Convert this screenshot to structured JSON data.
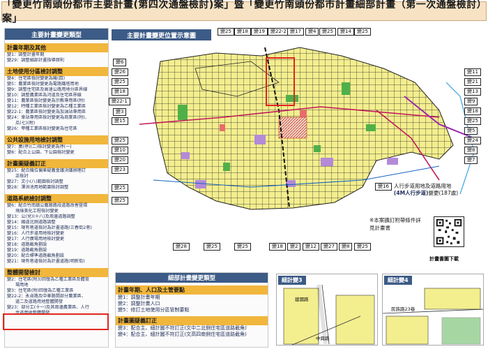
{
  "title": "「變更竹南頭份都市主要計畫(第四次通盤檢討)案」暨「變更竹南頭份都市計畫細部計畫（第一次通盤檢討）案」",
  "left_panel": {
    "header": "主要計畫變更類型",
    "categories": [
      {
        "title": "計畫年期及其他",
        "items": [
          "變1：調整計畫年期",
          "變29：調整細部計畫指導原則"
        ]
      },
      {
        "title": "土地使用分區檢討調整",
        "items": [
          "變4：住宅區檢討變更為機(四)",
          "變5：農業區檢討變更為電路鐵塔用地",
          "變9：調整住宅區及高速公路用地分區界線",
          "變10：調整農業區為河道及住宅區界線",
          "變11：農業區檢討變更為宗教專用區(附)",
          "變12：特種工業區檢討變更為乙種工業區",
          "變22-1：農業區檢討變更為加油站專用區",
          "變24：車站專用區檢討變更為商業區(附)、",
          "瓜(七)(附)",
          "變26：甲種工業區檢討變更為住宅區"
        ]
      },
      {
        "title": "公共設施用地檢討調整",
        "items": [
          "變7：廣(停)(二)檢討變更為停(一)",
          "變8：配合上公園、下公園檢討變更"
        ]
      },
      {
        "title": "計畫圖疑義訂正",
        "items": [
          "變25：配合機位偏差疑義會議決議辦理訂",
          "正檢討",
          "變27：文小(八)範圍檢討調整",
          "變28：澤洪池用地範圍檢討調整"
        ]
      },
      {
        "title": "道路系統檢討調整",
        "items": [
          "變6：配合竹南鎮公義路路段道路改善暨環",
          "境綠美化工程檢討變更",
          "變13：公(兒)(十八)及周邊道路調整",
          "變14：國道北側道路調整",
          "變15：現有巷道檢討為計畫道路(三春街2巷)",
          "變16：人行步道用地檢討變更",
          "變17：人行廣場用地檢討變更",
          "變18：道路截角劃設",
          "變19：道路截角劃設",
          "變20：配合標準道路截角劃設",
          "變21：現有巷道檢討為計畫道路(明新街)"
        ]
      },
      {
        "title": "整體開發檢討",
        "items": [
          "變2：住宅區(附3)回復為乙種工業區及體育",
          "場用地",
          "變3：住宅區(附)回復為乙種工業區",
          "變22-2：永貞路及中華路間部分農業區、",
          "道二及道路用地整體開發",
          "變23：部分工(十一)及其周邊農業區、人行",
          "步道用地整體開發"
        ]
      }
    ]
  },
  "map": {
    "title": "主要計畫變更位置示意圖",
    "top_labels": [
      "變25",
      "變18",
      "變19",
      "變22-2",
      "變17",
      "變4",
      "變25",
      "變14",
      "變25"
    ],
    "left_labels": [
      "變6",
      "變26",
      "變25",
      "變18",
      "變22-1",
      "變3",
      "變15",
      "變25",
      "變10",
      "變20",
      "變23",
      "變25",
      "變25"
    ],
    "right_labels": [
      "變11",
      "變21",
      "變13",
      "變9",
      "變18",
      "變25",
      "變5",
      "變24",
      "變8",
      "變7"
    ],
    "bottom_labels": [
      "變28",
      "變25",
      "變25",
      "變18",
      "變2",
      "變12",
      "變27",
      "變8",
      "變25"
    ],
    "legend_tag": "變16",
    "legend_line1": "人行步道用地及道路用地",
    "legend_line2_a": "(4M人行步道)",
    "legend_line2_b": "變更(187處)",
    "note": "※本案擴訂附帶條件詳見計畫書",
    "qr_caption": "計畫書圖下載"
  },
  "detail": {
    "header": "細部計畫變更類型",
    "categories": [
      {
        "title": "計畫年期、人口及土管要點",
        "items": [
          "變1：調整計畫年期",
          "變2：調整計畫人口",
          "變5：修訂土地使用分區管制要點"
        ]
      },
      {
        "title": "計畫圖疑義訂正",
        "items": [
          "變3：配合主、細計圖不符訂正(文中二北側住宅區道路截角)",
          "變4：配合主、細計圖不符訂正(文高四南側住宅區道路截角)"
        ]
      }
    ]
  },
  "detail_maps": [
    {
      "label": "細計變3",
      "road": "建國路",
      "road2": "中興路"
    },
    {
      "label": "細計變4",
      "road": "民族路23巷"
    }
  ],
  "colors": {
    "header_blue": "#3c5b86",
    "category_orange": "#f1b63c",
    "title_bg": "#f7e3c4",
    "highlight_red": "#e0261e",
    "residential_yellow": "#f3ee8e",
    "industrial_purple": "#b48ad8",
    "park_green": "#4fb04a",
    "commercial_red": "#e86b6b"
  }
}
